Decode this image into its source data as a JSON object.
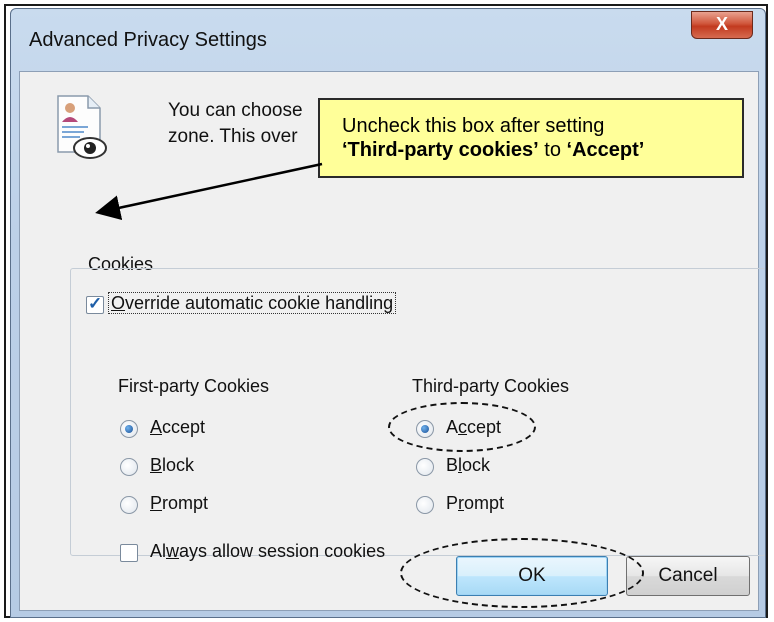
{
  "window": {
    "title": "Advanced Privacy Settings",
    "close_label": "X"
  },
  "description": {
    "line1": "You can choose",
    "line2": "zone.  This over"
  },
  "callout": {
    "line1": "Uncheck this box after setting",
    "line2_bold1": "‘Third-party cookies’",
    "line2_mid": " to ",
    "line2_bold2": "‘Accept’"
  },
  "cookies_group": {
    "legend": "Cookies",
    "override": {
      "label_prefix": "O",
      "label_rest": "verride automatic cookie handling",
      "checked": true
    },
    "first_party": {
      "heading": "First-party Cookies",
      "options": [
        {
          "key": "A",
          "rest": "ccept",
          "selected": true
        },
        {
          "key": "B",
          "rest": "lock",
          "selected": false
        },
        {
          "key": "P",
          "rest": "rompt",
          "selected": false
        }
      ]
    },
    "third_party": {
      "heading": "Third-party Cookies",
      "options": [
        {
          "pre": "A",
          "key": "c",
          "rest": "cept",
          "selected": true
        },
        {
          "pre": "B",
          "key": "l",
          "rest": "ock",
          "selected": false
        },
        {
          "pre": "P",
          "key": "r",
          "rest": "ompt",
          "selected": false
        }
      ]
    },
    "session": {
      "pre": "Al",
      "key": "w",
      "rest": "ays allow session cookies",
      "checked": false
    }
  },
  "buttons": {
    "ok": "OK",
    "cancel": "Cancel"
  },
  "icons": {
    "document": "document-eye-icon"
  },
  "colors": {
    "callout_bg": "#ffff99",
    "close_red": "#c23a1f",
    "client_bg": "#f0f0f0"
  }
}
